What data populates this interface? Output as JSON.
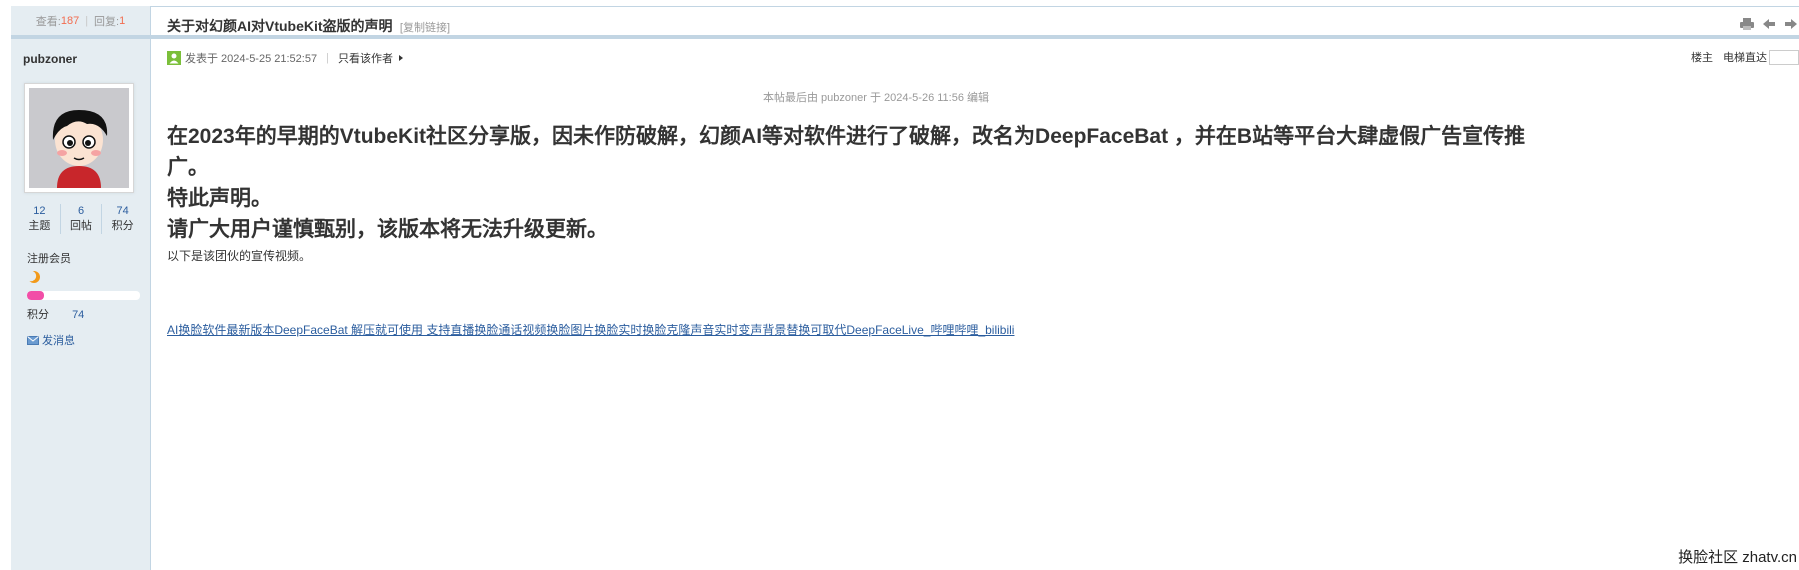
{
  "stats": {
    "views_label": "查看:",
    "views": "187",
    "replies_label": "回复:",
    "replies": "1"
  },
  "post": {
    "title": "关于对幻颜AI对VtubeKit盗版的声明",
    "copy_link": "[复制链接]",
    "posted_at": "发表于 2024-5-25 21:52:57",
    "only_author": "只看该作者",
    "floor": "楼主",
    "elevator": "电梯直达",
    "edit_note": "本帖最后由 pubzoner 于 2024-5-26 11:56 编辑",
    "lines": [
      "在2023年的早期的VtubeKit社区分享版，因未作防破解，幻颜AI等对软件进行了破解，改名为DeepFaceBat ，并在B站等平台大肆虚假广告宣传推广。",
      "特此声明。",
      "请广大用户谨慎甄别，该版本将无法升级更新。"
    ],
    "small_line": "以下是该团伙的宣传视频。",
    "video_link": "AI换脸软件最新版本DeepFaceBat 解压就可使用 支持直播换脸通话视频换脸图片换脸实时换脸克隆声音实时变声背景替换可取代DeepFaceLive_哔哩哔哩_bilibili"
  },
  "author": {
    "name": "pubzoner",
    "threads": "12",
    "threads_label": "主题",
    "posts": "6",
    "posts_label": "回帖",
    "points": "74",
    "points_label": "积分",
    "group": "注册会员",
    "level_progress": 0.15,
    "points_row_label": "积分",
    "points_row_value": "74",
    "send_message": "发消息"
  },
  "icons": {
    "print": "printer-icon",
    "prev": "arrow-left-icon",
    "next": "arrow-right-icon",
    "moon": "moon-icon",
    "mail": "mail-icon",
    "poster": "poster-icon"
  },
  "colors": {
    "accent": "#2b5d9e",
    "count": "#f26c4f",
    "progress": "#f24ea7",
    "sidebar_bg": "#e5edf2"
  },
  "watermark": "换脸社区 zhatv.cn"
}
